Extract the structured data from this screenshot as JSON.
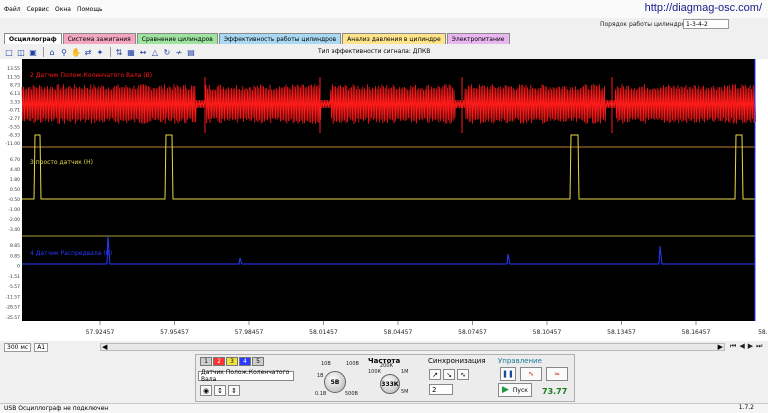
{
  "menu": [
    "Файл",
    "Сервис",
    "Окна",
    "Помощь"
  ],
  "site_link": "http://diagmag-osc.com/",
  "order_label": "Порядок работы цилиндров:",
  "order_value": "1-3-4-2",
  "tabs": [
    {
      "label": "Осциллограф",
      "color": "#ffffff",
      "active": true
    },
    {
      "label": "Система зажигания",
      "color": "#f3a7c0"
    },
    {
      "label": "Сравнение цилиндров",
      "color": "#9ee4a0"
    },
    {
      "label": "Эффективность работы цилиндров",
      "color": "#a9d8f2"
    },
    {
      "label": "Анализ давления в цилиндре",
      "color": "#ffe48c"
    },
    {
      "label": "Электропитание",
      "color": "#e8b7ef"
    }
  ],
  "toolbar": {
    "coef_label": "Тип эффективности сигнала: ДПКВ",
    "icons": [
      "new-file-icon",
      "open-folder-icon",
      "save-icon",
      "home-icon",
      "zoom-icon",
      "hand-icon",
      "measure-icon",
      "cursor-icon",
      "split-icon",
      "grid-icon",
      "range-icon",
      "filter-icon",
      "sync-icon",
      "fft-icon",
      "table-icon"
    ]
  },
  "scope": {
    "ch1_label": "2 Датчик Полож.Коленчатого Вала (В)",
    "ch2_label": "3 просто датчик (Н)",
    "ch3_label": "4 Датчик Распредвала (В)",
    "ch1_ticks": [
      "13.55",
      "11.55",
      "8.73",
      "6.13",
      "3.33",
      "-0.71",
      "-2.77",
      "-5.55",
      "-8.33",
      "-11.00"
    ],
    "ch2_ticks": [
      "6.70",
      "4.40",
      "1.80",
      "0.50",
      "-0.50",
      "-1.00",
      "-2.00",
      "-3.40"
    ],
    "ch3_ticks": [
      "8.85",
      "0.85",
      "0",
      "-1.51",
      "-5.57",
      "-11.57",
      "-28.57",
      "-35.57"
    ],
    "time_ticks": [
      "57.92457",
      "57.95457",
      "57.98457",
      "58.01457",
      "58.04457",
      "58.07457",
      "58.10457",
      "58.13457",
      "58.16457",
      "58.1945"
    ],
    "ch1_color": "#ff1a1a",
    "ch2_color": "#e6d84a",
    "ch3_color": "#2a3aff"
  },
  "scroll": {
    "timebase": "300 мс",
    "channels": "A1"
  },
  "control": {
    "channels": [
      "1",
      "2",
      "3",
      "4",
      "5"
    ],
    "sensor": "Датчик Полож.Коленчатого Вала",
    "volt_knob": "5В",
    "volt_range": [
      "10В",
      "1В",
      "0.1В",
      "100В",
      "500В"
    ],
    "freq_title": "Частота",
    "freq_knob": "333К",
    "freq_range": [
      "100К",
      "200К",
      "1М",
      "5М"
    ],
    "sync_title": "Синхронизация",
    "sync_value": "2",
    "control_title": "Управление",
    "start_label": "Пуск",
    "counter": "73.77"
  },
  "status": "USB Осциллограф не подключен",
  "version": "1.7.2"
}
